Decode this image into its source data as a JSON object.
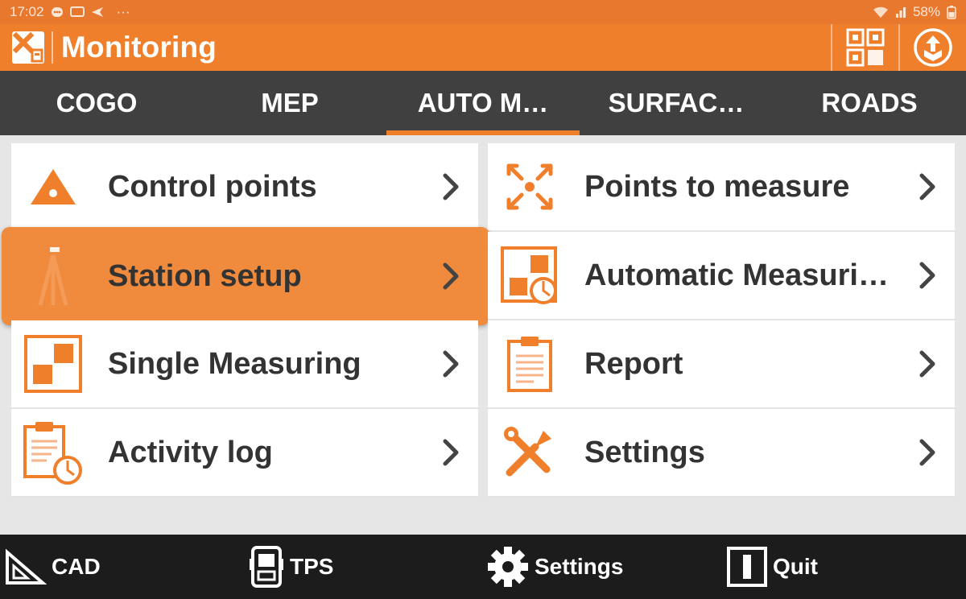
{
  "status_bar": {
    "time": "17:02",
    "dots": "···",
    "battery": "58%"
  },
  "header": {
    "title": "Monitoring"
  },
  "tabs": [
    {
      "label": "COGO",
      "active": false
    },
    {
      "label": "MEP",
      "active": false
    },
    {
      "label": "AUTO M…",
      "active": true
    },
    {
      "label": "SURFAC…",
      "active": false
    },
    {
      "label": "ROADS",
      "active": false
    }
  ],
  "menu": {
    "left": [
      {
        "label": "Control points",
        "icon": "control-points-icon"
      },
      {
        "label": "Station setup",
        "icon": "tripod-icon",
        "selected": true
      },
      {
        "label": "Single Measuring",
        "icon": "single-measuring-icon"
      },
      {
        "label": "Activity log",
        "icon": "activity-log-icon"
      }
    ],
    "right": [
      {
        "label": "Points to measure",
        "icon": "points-to-measure-icon"
      },
      {
        "label": "Automatic Measuri…",
        "icon": "automatic-measuring-icon"
      },
      {
        "label": "Report",
        "icon": "report-icon"
      },
      {
        "label": "Settings",
        "icon": "wrench-screwdriver-icon"
      }
    ]
  },
  "bottom_bar": {
    "cad": "CAD",
    "tps": "TPS",
    "settings": "Settings",
    "quit": "Quit"
  },
  "colors": {
    "accent": "#f07f2c",
    "tab_bar": "#404040",
    "bottom_bar": "#1c1c1c",
    "selected": "#f08a3c"
  }
}
